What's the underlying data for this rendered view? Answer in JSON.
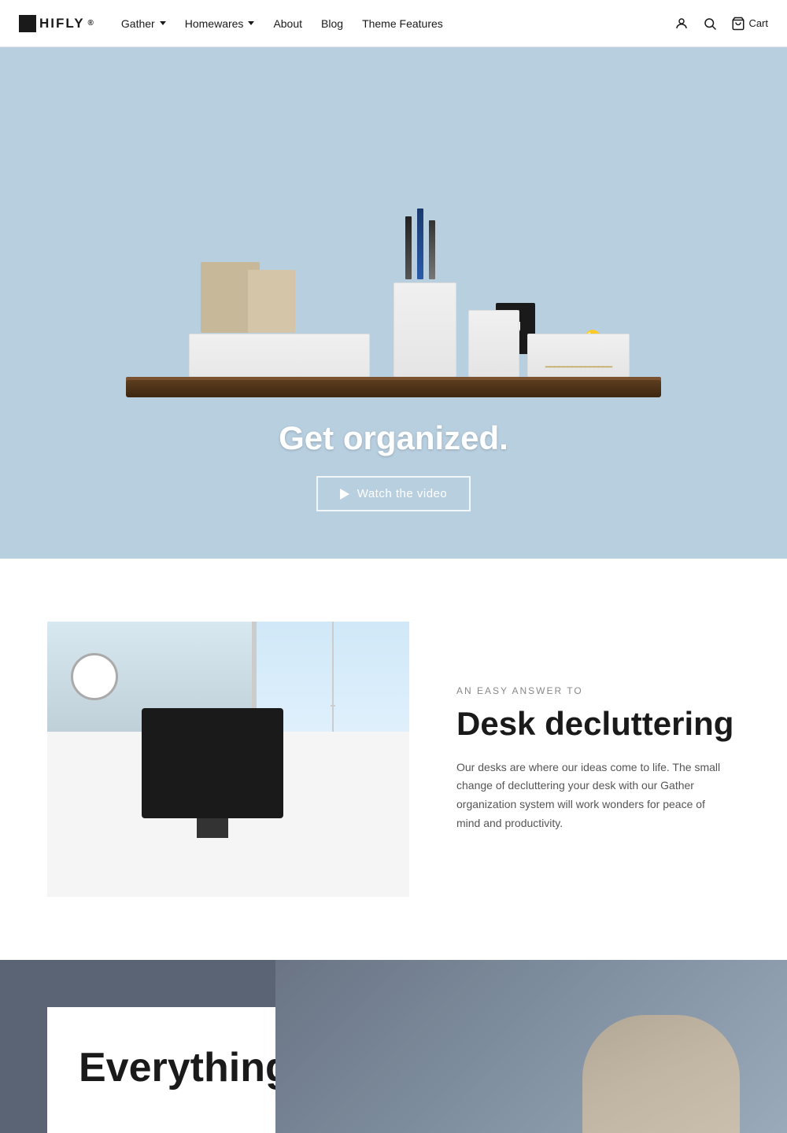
{
  "brand": {
    "name": "HIFLY",
    "registered": "®"
  },
  "nav": {
    "links": [
      {
        "label": "Gather",
        "has_dropdown": true
      },
      {
        "label": "Homewares",
        "has_dropdown": true
      },
      {
        "label": "About",
        "has_dropdown": false
      },
      {
        "label": "Blog",
        "has_dropdown": false
      },
      {
        "label": "Theme Features",
        "has_dropdown": false
      }
    ],
    "icons": {
      "account_label": "Log in",
      "search_label": "Search",
      "cart_label": "Cart"
    }
  },
  "hero": {
    "title": "Get organized.",
    "cta_label": "Watch the video"
  },
  "desk_section": {
    "eyebrow": "AN EASY ANSWER TO",
    "title": "Desk decluttering",
    "body": "Our desks are where our ideas come to life. The small change of decluttering your desk with our Gather organization system will work wonders for peace of mind and productivity."
  },
  "everything_section": {
    "title": "Everything"
  },
  "colors": {
    "hero_bg": "#b8cfe0",
    "everything_bg": "#5a6475",
    "brand": "#1a1a1a"
  }
}
